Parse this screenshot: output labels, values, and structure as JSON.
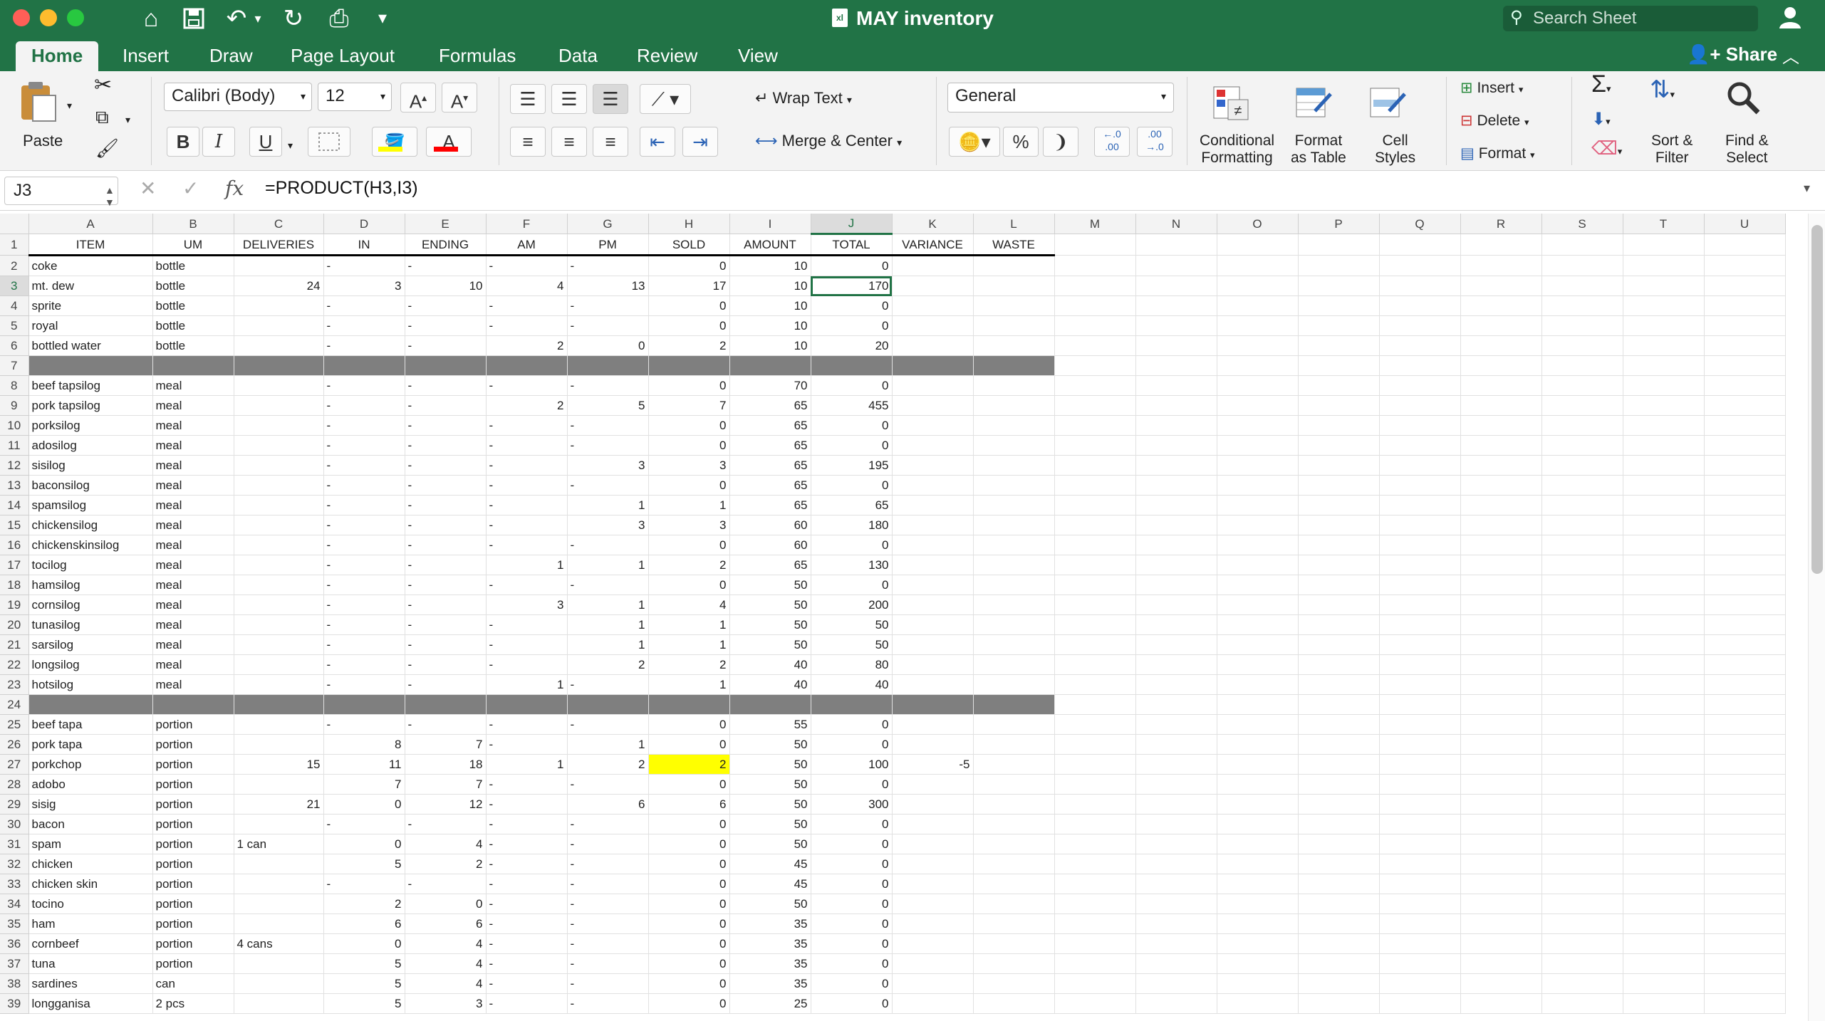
{
  "window": {
    "title": "MAY inventory",
    "doc_badge": "xl",
    "search_placeholder": "Search Sheet",
    "accent": "#217346"
  },
  "quick_access": {
    "home_icon": "⌂",
    "save_icon": "💾",
    "undo_icon": "↶",
    "redo_icon": "↻",
    "print_icon": "⎙",
    "customize_icon": "▾"
  },
  "tabs": [
    {
      "label": "Home",
      "active": true
    },
    {
      "label": "Insert"
    },
    {
      "label": "Draw"
    },
    {
      "label": "Page Layout"
    },
    {
      "label": "Formulas"
    },
    {
      "label": "Data"
    },
    {
      "label": "Review"
    },
    {
      "label": "View"
    }
  ],
  "share_label": "Share",
  "ribbon": {
    "paste": "Paste",
    "font_name": "Calibri (Body)",
    "font_size": "12",
    "wrap_text": "Wrap Text",
    "merge_center": "Merge & Center",
    "number_format": "General",
    "conditional_formatting": [
      "Conditional",
      "Formatting"
    ],
    "format_as_table": [
      "Format",
      "as Table"
    ],
    "cell_styles": [
      "Cell",
      "Styles"
    ],
    "insert": "Insert",
    "delete": "Delete",
    "format": "Format",
    "sort_filter": [
      "Sort &",
      "Filter"
    ],
    "find_select": [
      "Find &",
      "Select"
    ],
    "bold": "B",
    "italic": "I",
    "underline": "U",
    "percent": "%",
    "comma": "❩",
    "inc_decimal": "←.0\n.00",
    "dec_decimal": ".00\n→.0"
  },
  "formula_bar": {
    "name_box": "J3",
    "fx": "fx",
    "formula": "=PRODUCT(H3,I3)"
  },
  "sheet": {
    "columns": [
      "A",
      "B",
      "C",
      "D",
      "E",
      "F",
      "G",
      "H",
      "I",
      "J",
      "K",
      "L",
      "M",
      "N",
      "O",
      "P",
      "Q",
      "R",
      "S",
      "T",
      "U"
    ],
    "selected_column": "J",
    "selected_row": 3,
    "highlight_color": "#ffff00",
    "band_color": "#7f7f7f",
    "header_row": [
      "ITEM",
      "UM",
      "DELIVERIES",
      "IN",
      "ENDING",
      "AM",
      "PM",
      "SOLD",
      "AMOUNT",
      "TOTAL",
      "VARIANCE",
      "WASTE"
    ],
    "rows": [
      {
        "r": 2,
        "c": [
          "coke",
          "bottle",
          "",
          "-",
          "-",
          "-",
          "-",
          "0",
          "10",
          "0",
          "",
          ""
        ]
      },
      {
        "r": 3,
        "c": [
          "mt. dew",
          "bottle",
          "24",
          "3",
          "10",
          "4",
          "13",
          "17",
          "10",
          "170",
          "",
          ""
        ]
      },
      {
        "r": 4,
        "c": [
          "sprite",
          "bottle",
          "",
          "-",
          "-",
          "-",
          "-",
          "0",
          "10",
          "0",
          "",
          ""
        ]
      },
      {
        "r": 5,
        "c": [
          "royal",
          "bottle",
          "",
          "-",
          "-",
          "-",
          "-",
          "0",
          "10",
          "0",
          "",
          ""
        ]
      },
      {
        "r": 6,
        "c": [
          "bottled water",
          "bottle",
          "",
          "-",
          "-",
          "2",
          "0",
          "2",
          "10",
          "20",
          "",
          ""
        ]
      },
      {
        "r": 7,
        "band": true
      },
      {
        "r": 8,
        "c": [
          "beef tapsilog",
          "meal",
          "",
          "-",
          "-",
          "-",
          "-",
          "0",
          "70",
          "0",
          "",
          ""
        ]
      },
      {
        "r": 9,
        "c": [
          "pork tapsilog",
          "meal",
          "",
          "-",
          "-",
          "2",
          "5",
          "7",
          "65",
          "455",
          "",
          ""
        ]
      },
      {
        "r": 10,
        "c": [
          "porksilog",
          "meal",
          "",
          "-",
          "-",
          "-",
          "-",
          "0",
          "65",
          "0",
          "",
          ""
        ]
      },
      {
        "r": 11,
        "c": [
          "adosilog",
          "meal",
          "",
          "-",
          "-",
          "-",
          "-",
          "0",
          "65",
          "0",
          "",
          ""
        ]
      },
      {
        "r": 12,
        "c": [
          "sisilog",
          "meal",
          "",
          "-",
          "-",
          "-",
          "3",
          "3",
          "65",
          "195",
          "",
          ""
        ]
      },
      {
        "r": 13,
        "c": [
          "baconsilog",
          "meal",
          "",
          "-",
          "-",
          "-",
          "-",
          "0",
          "65",
          "0",
          "",
          ""
        ]
      },
      {
        "r": 14,
        "c": [
          "spamsilog",
          "meal",
          "",
          "-",
          "-",
          "-",
          "1",
          "1",
          "65",
          "65",
          "",
          ""
        ]
      },
      {
        "r": 15,
        "c": [
          "chickensilog",
          "meal",
          "",
          "-",
          "-",
          "-",
          "3",
          "3",
          "60",
          "180",
          "",
          ""
        ]
      },
      {
        "r": 16,
        "c": [
          "chickenskinsilog",
          "meal",
          "",
          "-",
          "-",
          "-",
          "-",
          "0",
          "60",
          "0",
          "",
          ""
        ]
      },
      {
        "r": 17,
        "c": [
          "tocilog",
          "meal",
          "",
          "-",
          "-",
          "1",
          "1",
          "2",
          "65",
          "130",
          "",
          ""
        ]
      },
      {
        "r": 18,
        "c": [
          "hamsilog",
          "meal",
          "",
          "-",
          "-",
          "-",
          "-",
          "0",
          "50",
          "0",
          "",
          ""
        ]
      },
      {
        "r": 19,
        "c": [
          "cornsilog",
          "meal",
          "",
          "-",
          "-",
          "3",
          "1",
          "4",
          "50",
          "200",
          "",
          ""
        ]
      },
      {
        "r": 20,
        "c": [
          "tunasilog",
          "meal",
          "",
          "-",
          "-",
          "-",
          "1",
          "1",
          "50",
          "50",
          "",
          ""
        ]
      },
      {
        "r": 21,
        "c": [
          "sarsilog",
          "meal",
          "",
          "-",
          "-",
          "-",
          "1",
          "1",
          "50",
          "50",
          "",
          ""
        ]
      },
      {
        "r": 22,
        "c": [
          "longsilog",
          "meal",
          "",
          "-",
          "-",
          "-",
          "2",
          "2",
          "40",
          "80",
          "",
          ""
        ]
      },
      {
        "r": 23,
        "c": [
          "hotsilog",
          "meal",
          "",
          "-",
          "-",
          "1",
          "-",
          "1",
          "40",
          "40",
          "",
          ""
        ]
      },
      {
        "r": 24,
        "band": true
      },
      {
        "r": 25,
        "c": [
          "beef tapa",
          "portion",
          "",
          "-",
          "-",
          "-",
          "-",
          "0",
          "55",
          "0",
          "",
          ""
        ]
      },
      {
        "r": 26,
        "c": [
          "pork tapa",
          "portion",
          "",
          "8",
          "7",
          "-",
          "1",
          "0",
          "50",
          "0",
          "",
          ""
        ]
      },
      {
        "r": 27,
        "c": [
          "porkchop",
          "portion",
          "15",
          "11",
          "18",
          "1",
          "2",
          "2",
          "50",
          "100",
          "-5",
          ""
        ],
        "hl": 7
      },
      {
        "r": 28,
        "c": [
          "adobo",
          "portion",
          "",
          "7",
          "7",
          "-",
          "-",
          "0",
          "50",
          "0",
          "",
          ""
        ]
      },
      {
        "r": 29,
        "c": [
          "sisig",
          "portion",
          "21",
          "0",
          "12",
          "-",
          "6",
          "6",
          "50",
          "300",
          "",
          ""
        ]
      },
      {
        "r": 30,
        "c": [
          "bacon",
          "portion",
          "",
          "-",
          "-",
          "-",
          "-",
          "0",
          "50",
          "0",
          "",
          ""
        ]
      },
      {
        "r": 31,
        "c": [
          "spam",
          "portion",
          "1 can",
          "0",
          "4",
          "-",
          "-",
          "0",
          "50",
          "0",
          "",
          ""
        ]
      },
      {
        "r": 32,
        "c": [
          "chicken",
          "portion",
          "",
          "5",
          "2",
          "-",
          "-",
          "0",
          "45",
          "0",
          "",
          ""
        ]
      },
      {
        "r": 33,
        "c": [
          "chicken skin",
          "portion",
          "",
          "-",
          "-",
          "-",
          "-",
          "0",
          "45",
          "0",
          "",
          ""
        ]
      },
      {
        "r": 34,
        "c": [
          "tocino",
          "portion",
          "",
          "2",
          "0",
          "-",
          "-",
          "0",
          "50",
          "0",
          "",
          ""
        ]
      },
      {
        "r": 35,
        "c": [
          "ham",
          "portion",
          "",
          "6",
          "6",
          "-",
          "-",
          "0",
          "35",
          "0",
          "",
          ""
        ]
      },
      {
        "r": 36,
        "c": [
          "cornbeef",
          "portion",
          "4 cans",
          "0",
          "4",
          "-",
          "-",
          "0",
          "35",
          "0",
          "",
          ""
        ]
      },
      {
        "r": 37,
        "c": [
          "tuna",
          "portion",
          "",
          "5",
          "4",
          "-",
          "-",
          "0",
          "35",
          "0",
          "",
          ""
        ]
      },
      {
        "r": 38,
        "c": [
          "sardines",
          "can",
          "",
          "5",
          "4",
          "-",
          "-",
          "0",
          "35",
          "0",
          "",
          ""
        ]
      },
      {
        "r": 39,
        "c": [
          "longganisa",
          "2 pcs",
          "",
          "5",
          "3",
          "-",
          "-",
          "0",
          "25",
          "0",
          "",
          ""
        ]
      }
    ]
  }
}
